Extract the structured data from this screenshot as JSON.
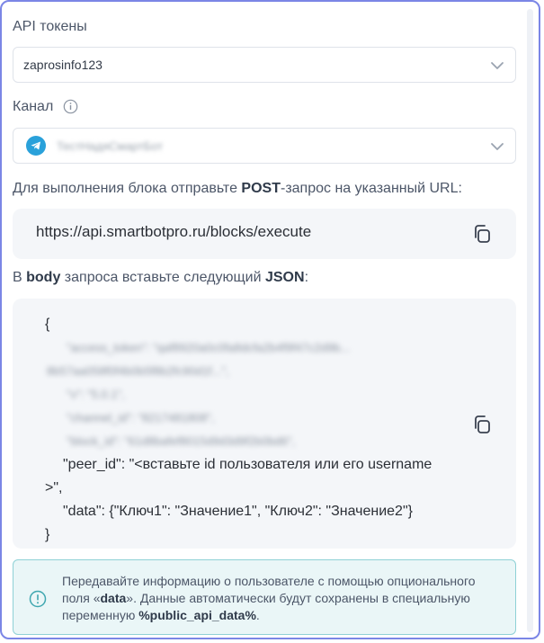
{
  "tokens": {
    "label": "API токены",
    "selected": "zaprosinfo123"
  },
  "channel": {
    "label": "Канал",
    "selected": "ТестНадяСмартБот"
  },
  "instruction": {
    "prefix": "Для выполнения блока отправьте ",
    "method": "POST",
    "suffix": "-запрос на указанный URL:"
  },
  "endpoint": {
    "url": "https://api.smartbotpro.ru/blocks/execute"
  },
  "body_instruction": {
    "prefix": "В ",
    "body_word": "body",
    "middle": " запроса вставьте следующий ",
    "json_word": "JSON",
    "suffix": ":"
  },
  "json": {
    "open": "{",
    "hidden_1": "\"access_token\": \"qaf8920a0c0fa8dcfa2b4f9f47c2d9b...",
    "hidden_2": "8b57aa058f0f4b0b5f8b2fc90d1f...\",",
    "hidden_3": "\"v\": \"5.0.1\",",
    "hidden_4": "\"channel_id\": \"8217481808\",",
    "hidden_5": "\"block_id\": \"61d8bafef8015d9d3d9f2b0bd6\",",
    "peer_line": "\"peer_id\": \"<вставьте id пользователя или его username",
    "peer_line_end": ">\",",
    "data_line": "\"data\": {\"Ключ1\": \"Значение1\", \"Ключ2\": \"Значение2\"}",
    "close": "}"
  },
  "note": {
    "text_1": "Передавайте информацию о пользователе с помощью опционального поля «",
    "data_word": "data",
    "text_2": "». Данные автоматически будут сохранены в специальную переменную ",
    "variable": "%public_api_data%",
    "text_3": "."
  },
  "colors": {
    "border": "#7b86e6",
    "code_bg": "#f4f6f9",
    "note_bg": "#eaf6f7",
    "note_border": "#8fd1d6",
    "telegram": "#2aa1da"
  }
}
